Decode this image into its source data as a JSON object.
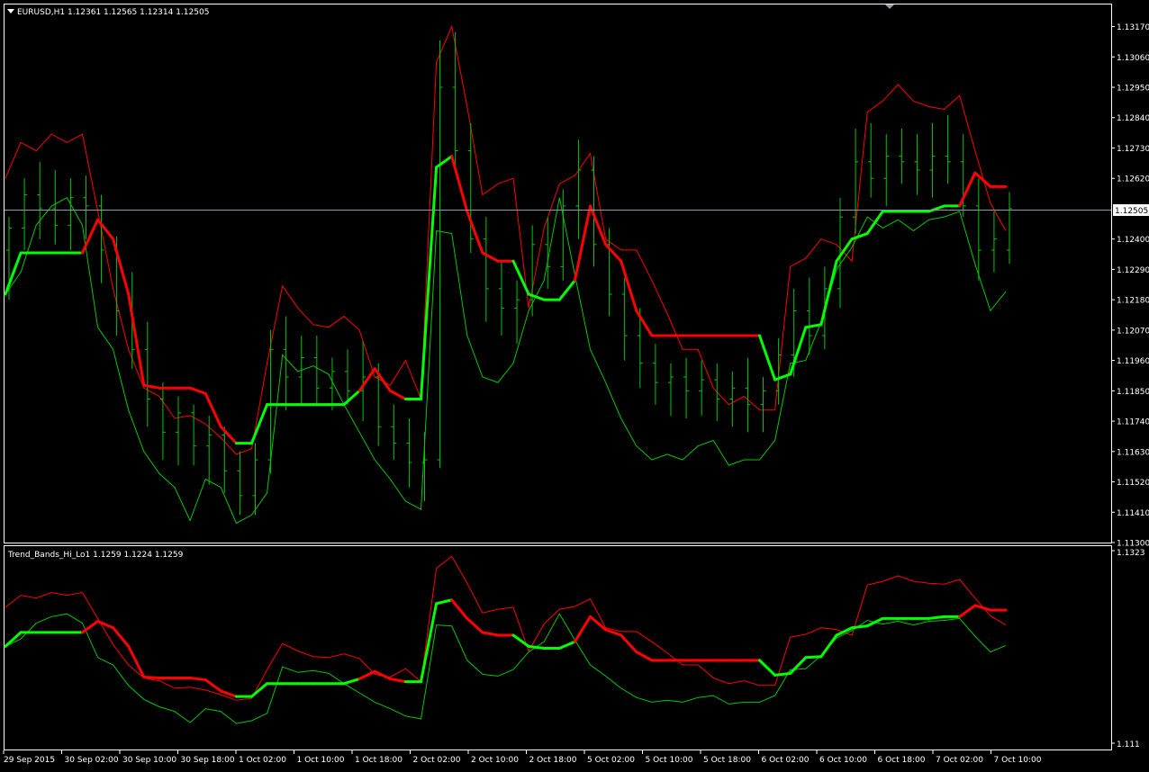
{
  "main_pane": {
    "title": "EURUSD,H1  1.12361 1.12565 1.12314 1.12505",
    "current_price": "1.12505",
    "price_ticks": [
      "1.13170",
      "1.13060",
      "1.12950",
      "1.12840",
      "1.12730",
      "1.12620",
      "1.12400",
      "1.12290",
      "1.12180",
      "1.12070",
      "1.11960",
      "1.11850",
      "1.11740",
      "1.11630",
      "1.11520",
      "1.11410",
      "1.11300"
    ]
  },
  "sub_pane": {
    "title": "Trend_Bands_Hi_Lo1 1.1259 1.1224 1.1259",
    "top_tick": "1.1323",
    "bottom_tick": "1.111"
  },
  "time_axis": {
    "labels": [
      "29 Sep 2015",
      "30 Sep 02:00",
      "30 Sep 10:00",
      "30 Sep 18:00",
      "1 Oct 02:00",
      "1 Oct 10:00",
      "1 Oct 18:00",
      "2 Oct 02:00",
      "2 Oct 10:00",
      "2 Oct 18:00",
      "5 Oct 02:00",
      "5 Oct 10:00",
      "5 Oct 18:00",
      "6 Oct 02:00",
      "6 Oct 10:00",
      "6 Oct 18:00",
      "7 Oct 02:00",
      "7 Oct 10:00"
    ]
  },
  "colors": {
    "background": "#000000",
    "axis": "#ffffff",
    "candles": "#00c800",
    "upper_band": "#ff0000",
    "lower_band": "#00c800",
    "trend_down": "#ff0000",
    "trend_up": "#00ff00",
    "price_line": "#8c9ab0"
  },
  "chart_data": {
    "type": "line",
    "symbol": "EURUSD",
    "timeframe": "H1",
    "ohlc_last": {
      "open": 1.12361,
      "high": 1.12565,
      "low": 1.12314,
      "close": 1.12505
    },
    "ylim": [
      1.113,
      1.1325
    ],
    "sub_ylim": [
      1.111,
      1.1323
    ],
    "x": [
      "29 Sep 2015",
      "30 Sep 02:00",
      "30 Sep 10:00",
      "30 Sep 18:00",
      "1 Oct 02:00",
      "1 Oct 10:00",
      "1 Oct 18:00",
      "2 Oct 02:00",
      "2 Oct 10:00",
      "2 Oct 18:00",
      "5 Oct 02:00",
      "5 Oct 10:00",
      "5 Oct 18:00",
      "6 Oct 02:00",
      "6 Oct 10:00",
      "6 Oct 18:00",
      "7 Oct 02:00",
      "7 Oct 10:00"
    ],
    "upper_band": [
      1.1262,
      1.1275,
      1.1272,
      1.1278,
      1.1275,
      1.1278,
      1.125,
      1.1222,
      1.12,
      1.1186,
      1.1183,
      1.1175,
      1.1176,
      1.1173,
      1.1168,
      1.1162,
      1.1164,
      1.1195,
      1.1223,
      1.1215,
      1.1209,
      1.1208,
      1.1212,
      1.1207,
      1.119,
      1.1187,
      1.1196,
      1.1182,
      1.1304,
      1.1317,
      1.1288,
      1.1256,
      1.126,
      1.1262,
      1.1215,
      1.1244,
      1.126,
      1.1263,
      1.1271,
      1.124,
      1.1236,
      1.1236,
      1.1225,
      1.1213,
      1.12,
      1.12,
      1.1186,
      1.118,
      1.1183,
      1.1178,
      1.1178,
      1.123,
      1.1233,
      1.124,
      1.1238,
      1.1232,
      1.1286,
      1.129,
      1.1296,
      1.129,
      1.1288,
      1.1287,
      1.1292,
      1.1272,
      1.1253,
      1.1243
    ],
    "lower_band": [
      1.122,
      1.1228,
      1.1245,
      1.1252,
      1.1255,
      1.1245,
      1.1208,
      1.12,
      1.1178,
      1.1163,
      1.1155,
      1.115,
      1.1138,
      1.1153,
      1.115,
      1.1137,
      1.114,
      1.1148,
      1.1198,
      1.1192,
      1.1194,
      1.1191,
      1.118,
      1.117,
      1.116,
      1.1153,
      1.1145,
      1.1142,
      1.1243,
      1.1242,
      1.1205,
      1.119,
      1.1188,
      1.1195,
      1.1214,
      1.1225,
      1.1255,
      1.1227,
      1.12,
      1.1188,
      1.1175,
      1.1165,
      1.116,
      1.1162,
      1.116,
      1.1165,
      1.1167,
      1.1158,
      1.116,
      1.116,
      1.1167,
      1.1195,
      1.1196,
      1.121,
      1.1229,
      1.1237,
      1.1248,
      1.1244,
      1.1247,
      1.1243,
      1.1247,
      1.1248,
      1.125,
      1.1231,
      1.1214,
      1.1221
    ],
    "trend_line": [
      1.122,
      1.1235,
      1.1235,
      1.1235,
      1.1235,
      1.1235,
      1.1247,
      1.124,
      1.122,
      1.1187,
      1.1186,
      1.1186,
      1.1186,
      1.1184,
      1.1172,
      1.1166,
      1.1166,
      1.118,
      1.118,
      1.118,
      1.118,
      1.118,
      1.118,
      1.1185,
      1.1193,
      1.1185,
      1.1182,
      1.1182,
      1.1266,
      1.127,
      1.125,
      1.1235,
      1.1232,
      1.1232,
      1.122,
      1.1218,
      1.1218,
      1.1225,
      1.1252,
      1.1238,
      1.1232,
      1.1214,
      1.1205,
      1.1205,
      1.1205,
      1.1205,
      1.1205,
      1.1205,
      1.1205,
      1.1205,
      1.1189,
      1.1191,
      1.1208,
      1.1209,
      1.1232,
      1.124,
      1.1242,
      1.125,
      1.125,
      1.125,
      1.125,
      1.1252,
      1.1252,
      1.1264,
      1.1259,
      1.1259
    ],
    "trend_direction": [
      "up",
      "up",
      "up",
      "up",
      "up",
      "up",
      "down",
      "down",
      "down",
      "down",
      "down",
      "down",
      "down",
      "down",
      "down",
      "down",
      "up",
      "up",
      "up",
      "up",
      "up",
      "up",
      "up",
      "up",
      "down",
      "down",
      "down",
      "up",
      "up",
      "up",
      "down",
      "down",
      "down",
      "down",
      "up",
      "up",
      "up",
      "up",
      "down",
      "down",
      "down",
      "down",
      "down",
      "down",
      "down",
      "down",
      "down",
      "down",
      "down",
      "down",
      "up",
      "up",
      "up",
      "up",
      "up",
      "up",
      "up",
      "up",
      "up",
      "up",
      "up",
      "up",
      "up",
      "down",
      "down",
      "down"
    ],
    "candles": [
      [
        1.1236,
        1.1248,
        1.1218,
        1.1244
      ],
      [
        1.1244,
        1.1262,
        1.1236,
        1.1256
      ],
      [
        1.1256,
        1.1268,
        1.124,
        1.1251
      ],
      [
        1.1251,
        1.1265,
        1.1238,
        1.1245
      ],
      [
        1.1245,
        1.1262,
        1.1236,
        1.1255
      ],
      [
        1.1255,
        1.1263,
        1.124,
        1.1252
      ],
      [
        1.1252,
        1.1256,
        1.1224,
        1.1236
      ],
      [
        1.1236,
        1.1241,
        1.1205,
        1.1214
      ],
      [
        1.1214,
        1.1228,
        1.1193,
        1.12
      ],
      [
        1.12,
        1.121,
        1.1172,
        1.1182
      ],
      [
        1.1182,
        1.1188,
        1.116,
        1.117
      ],
      [
        1.117,
        1.1183,
        1.1158,
        1.1177
      ],
      [
        1.1177,
        1.118,
        1.1158,
        1.1165
      ],
      [
        1.1165,
        1.1176,
        1.1151,
        1.1169
      ],
      [
        1.1169,
        1.1172,
        1.1148,
        1.1156
      ],
      [
        1.1156,
        1.1163,
        1.114,
        1.1147
      ],
      [
        1.1147,
        1.1166,
        1.114,
        1.116
      ],
      [
        1.116,
        1.1207,
        1.1155,
        1.12
      ],
      [
        1.12,
        1.1212,
        1.1178,
        1.119
      ],
      [
        1.119,
        1.1205,
        1.118,
        1.1197
      ],
      [
        1.1197,
        1.1205,
        1.118,
        1.1186
      ],
      [
        1.1186,
        1.1197,
        1.1178,
        1.1192
      ],
      [
        1.1192,
        1.12,
        1.118,
        1.1185
      ],
      [
        1.1185,
        1.1203,
        1.1174,
        1.119
      ],
      [
        1.119,
        1.1195,
        1.1165,
        1.1172
      ],
      [
        1.1172,
        1.118,
        1.116,
        1.1166
      ],
      [
        1.1166,
        1.1175,
        1.115,
        1.1159
      ],
      [
        1.1159,
        1.117,
        1.1145,
        1.116
      ],
      [
        1.116,
        1.1312,
        1.1157,
        1.1295
      ],
      [
        1.1295,
        1.1315,
        1.1265,
        1.1272
      ],
      [
        1.1272,
        1.1282,
        1.1235,
        1.124
      ],
      [
        1.124,
        1.1248,
        1.121,
        1.1222
      ],
      [
        1.1222,
        1.1232,
        1.1205,
        1.1215
      ],
      [
        1.1215,
        1.1225,
        1.1202,
        1.1218
      ],
      [
        1.1218,
        1.1245,
        1.1212,
        1.1238
      ],
      [
        1.1238,
        1.1248,
        1.1222,
        1.123
      ],
      [
        1.123,
        1.1258,
        1.1225,
        1.1252
      ],
      [
        1.1252,
        1.1276,
        1.124,
        1.1265
      ],
      [
        1.1265,
        1.127,
        1.123,
        1.1238
      ],
      [
        1.1238,
        1.1244,
        1.1212,
        1.122
      ],
      [
        1.122,
        1.1226,
        1.1196,
        1.1205
      ],
      [
        1.1205,
        1.1215,
        1.1186,
        1.1195
      ],
      [
        1.1195,
        1.1202,
        1.118,
        1.1188
      ],
      [
        1.1188,
        1.1195,
        1.1176,
        1.119
      ],
      [
        1.119,
        1.1197,
        1.1175,
        1.1185
      ],
      [
        1.1185,
        1.1196,
        1.1176,
        1.1189
      ],
      [
        1.1189,
        1.1195,
        1.1174,
        1.1182
      ],
      [
        1.1182,
        1.1192,
        1.1172,
        1.1186
      ],
      [
        1.1186,
        1.1197,
        1.117,
        1.118
      ],
      [
        1.118,
        1.119,
        1.117,
        1.1185
      ],
      [
        1.1185,
        1.1204,
        1.118,
        1.1198
      ],
      [
        1.1198,
        1.1222,
        1.119,
        1.1214
      ],
      [
        1.1214,
        1.1226,
        1.1198,
        1.1205
      ],
      [
        1.1205,
        1.123,
        1.12,
        1.1222
      ],
      [
        1.1222,
        1.1255,
        1.1215,
        1.1248
      ],
      [
        1.1248,
        1.128,
        1.1242,
        1.1268
      ],
      [
        1.1268,
        1.1282,
        1.1255,
        1.1262
      ],
      [
        1.1262,
        1.1278,
        1.1252,
        1.127
      ],
      [
        1.127,
        1.128,
        1.126,
        1.1268
      ],
      [
        1.1268,
        1.1278,
        1.1256,
        1.1265
      ],
      [
        1.1265,
        1.1282,
        1.1255,
        1.127
      ],
      [
        1.127,
        1.1285,
        1.126,
        1.1268
      ],
      [
        1.1268,
        1.1278,
        1.1248,
        1.1252
      ],
      [
        1.1252,
        1.1262,
        1.1225,
        1.1236
      ],
      [
        1.1236,
        1.125,
        1.1228,
        1.124
      ],
      [
        1.1236,
        1.1257,
        1.1231,
        1.1251
      ]
    ]
  }
}
